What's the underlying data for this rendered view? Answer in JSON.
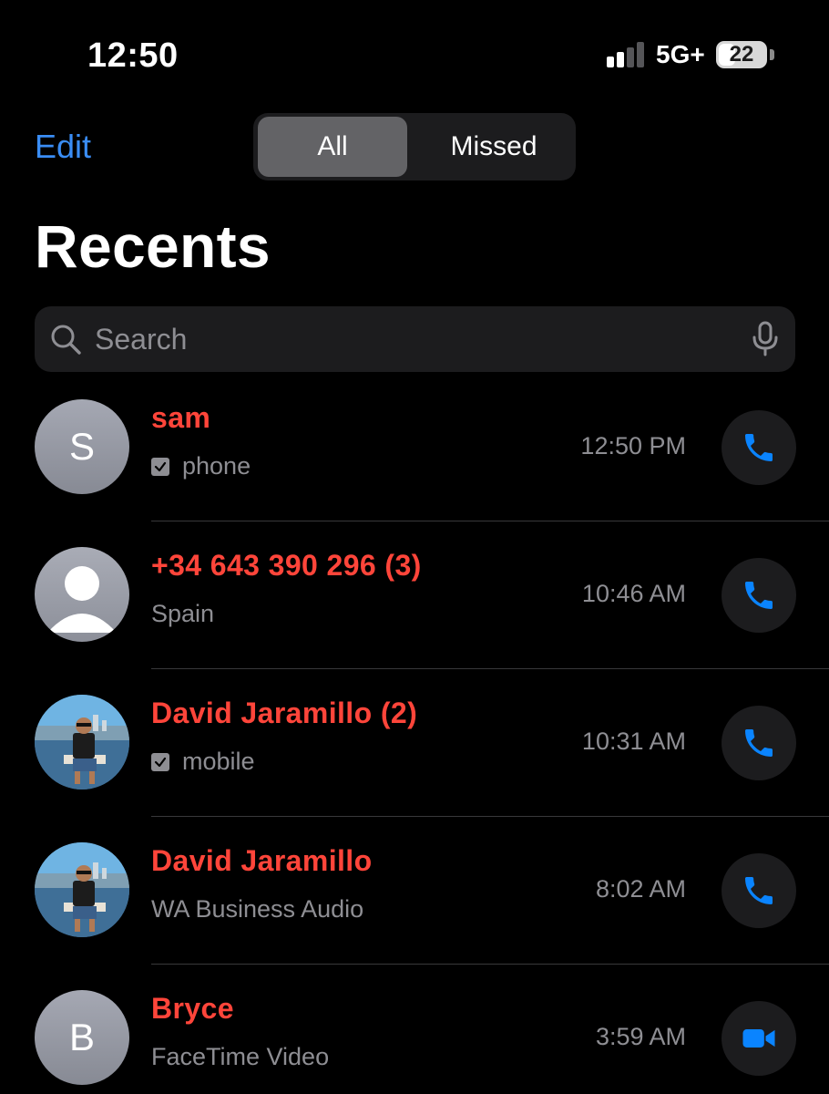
{
  "status_bar": {
    "time": "12:50",
    "network": "5G+",
    "battery_percent": "22",
    "signal_bars_active": 2,
    "signal_bars_total": 4
  },
  "header": {
    "edit_label": "Edit",
    "segments": [
      {
        "label": "All",
        "selected": true
      },
      {
        "label": "Missed",
        "selected": false
      }
    ],
    "title": "Recents"
  },
  "search": {
    "placeholder": "Search"
  },
  "colors": {
    "accent_blue": "#3a8df5",
    "missed_red": "#ff453a",
    "secondary_text": "#8e8e93",
    "background": "#000000",
    "surface": "#1c1c1e"
  },
  "calls": [
    {
      "name": "sam",
      "detail": "phone",
      "detail_checkmark": true,
      "time": "12:50 PM",
      "avatar": {
        "type": "initial",
        "initial": "S"
      },
      "action_icon": "phone-icon"
    },
    {
      "name": "+34 643 390 296 (3)",
      "detail": "Spain",
      "detail_checkmark": false,
      "time": "10:46 AM",
      "avatar": {
        "type": "generic",
        "initial": ""
      },
      "action_icon": "phone-icon"
    },
    {
      "name": "David Jaramillo (2)",
      "detail": "mobile",
      "detail_checkmark": true,
      "time": "10:31 AM",
      "avatar": {
        "type": "photo",
        "initial": ""
      },
      "action_icon": "phone-icon"
    },
    {
      "name": "David Jaramillo",
      "detail": "WA Business Audio",
      "detail_checkmark": false,
      "time": "8:02 AM",
      "avatar": {
        "type": "photo",
        "initial": ""
      },
      "action_icon": "phone-icon"
    },
    {
      "name": "Bryce",
      "detail": "FaceTime Video",
      "detail_checkmark": false,
      "time": "3:59 AM",
      "avatar": {
        "type": "initial",
        "initial": "B"
      },
      "action_icon": "video-camera-icon"
    }
  ]
}
